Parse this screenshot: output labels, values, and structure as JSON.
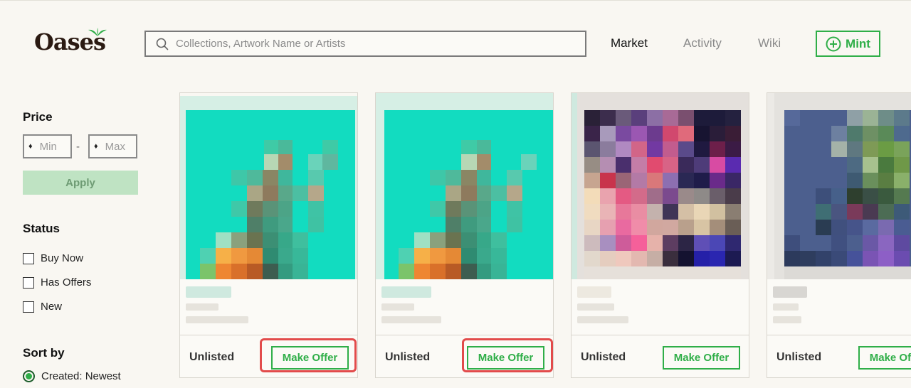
{
  "header": {
    "logo": "Oases",
    "search_placeholder": "Collections, Artwork Name or Artists",
    "nav": [
      "Market",
      "Activity",
      "Wiki"
    ],
    "mint_label": "Mint"
  },
  "sidebar": {
    "price_title": "Price",
    "min_placeholder": "Min",
    "max_placeholder": "Max",
    "dash": "-",
    "apply_label": "Apply",
    "status_title": "Status",
    "status_options": [
      "Buy Now",
      "Has Offers",
      "New"
    ],
    "sort_title": "Sort by",
    "sort_selected": "Created: Newest"
  },
  "cards": [
    {
      "status": "Unlisted",
      "action": "Make Offer",
      "highlighted": true
    },
    {
      "status": "Unlisted",
      "action": "Make Offer",
      "highlighted": true
    },
    {
      "status": "Unlisted",
      "action": "Make Offer",
      "highlighted": false
    },
    {
      "status": "Unlisted",
      "action": "Make Offer",
      "highlighted": false
    }
  ],
  "colors": {
    "accent": "#2fae48",
    "highlight": "#e24b4b",
    "background": "#f9f7f2"
  }
}
